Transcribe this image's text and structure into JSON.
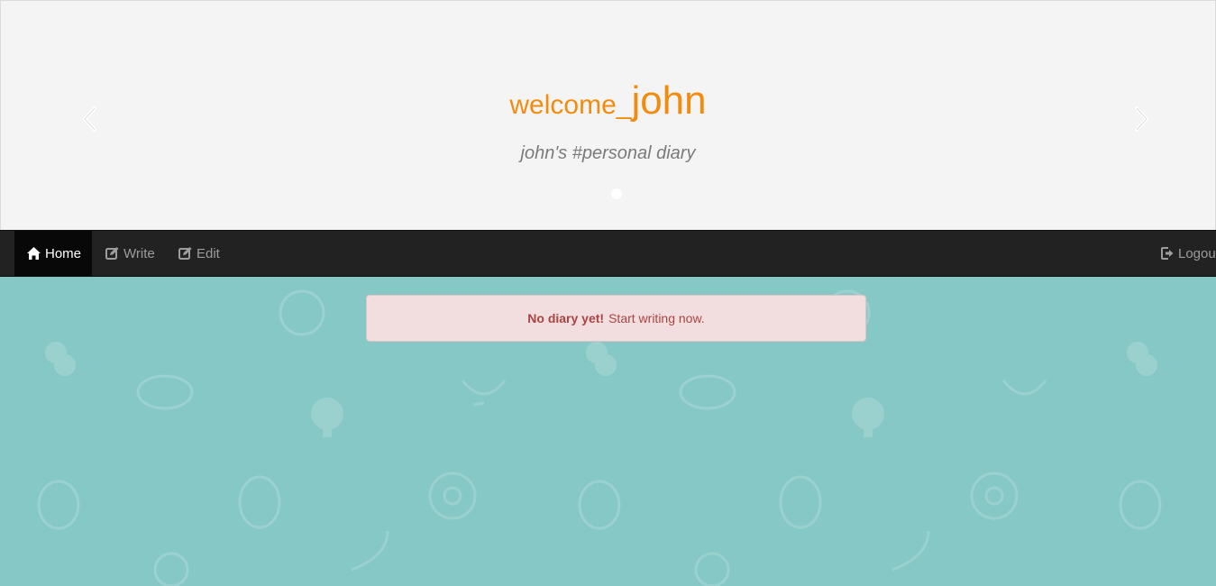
{
  "header": {
    "welcome_prefix": "welcome_",
    "username": "john",
    "subtitle": "john's #personal diary",
    "prev_icon": "chevron-left-icon",
    "next_icon": "chevron-right-icon"
  },
  "nav": {
    "home_label": "Home",
    "write_label": "Write",
    "edit_label": "Edit",
    "logout_label": "Logout",
    "home_icon": "home-icon",
    "write_icon": "edit-icon",
    "edit_icon": "edit-icon",
    "logout_icon": "logout-icon"
  },
  "alert": {
    "strong": "No diary yet!",
    "message": "Start writing now."
  },
  "colors": {
    "accent": "#f28c0f",
    "background": "#86c8c6",
    "navbar": "#222222",
    "alert_bg": "#f2dede",
    "alert_text": "#a94442"
  }
}
